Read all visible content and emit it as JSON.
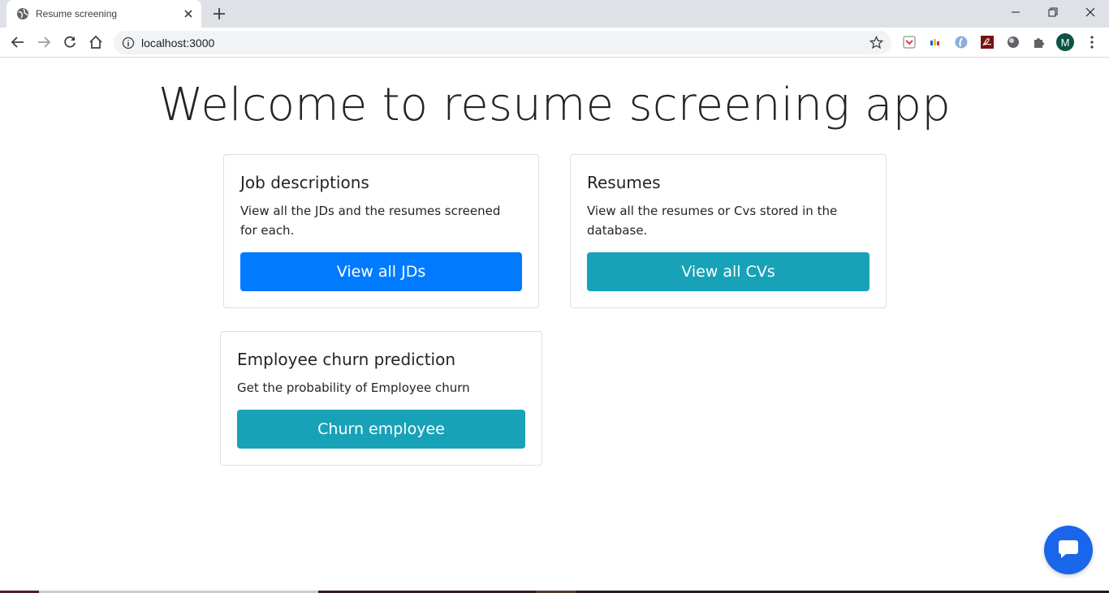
{
  "browser": {
    "tab_title": "Resume screening",
    "url": "localhost:3000",
    "profile_initial": "M",
    "extensions": [
      "pocket-icon",
      "colorful-extension-icon",
      "blue-circle-extension-icon",
      "pdf-extension-icon",
      "dark-circle-extension-icon",
      "puzzle-icon"
    ]
  },
  "page": {
    "title": "Welcome to resume screening app",
    "cards": [
      {
        "title": "Job descriptions",
        "text": "View all the JDs and the resumes screened for each.",
        "button": "View all JDs"
      },
      {
        "title": "Resumes",
        "text": "View all the resumes or Cvs stored in the database.",
        "button": "View all CVs"
      },
      {
        "title": "Employee churn prediction",
        "text": "Get the probability of Employee churn",
        "button": "Churn employee"
      }
    ]
  },
  "colors": {
    "primary": "#007bff",
    "info": "#17a2b8",
    "chat": "#1a66ea"
  }
}
